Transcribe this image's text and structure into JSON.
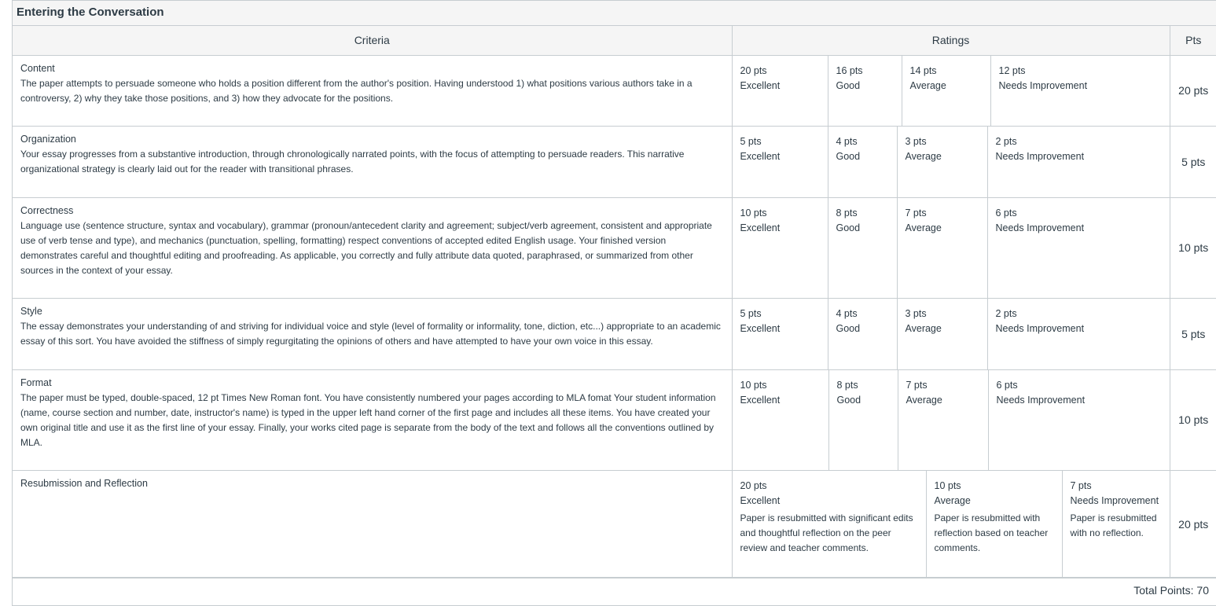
{
  "title": "Entering the Conversation",
  "headers": {
    "criteria": "Criteria",
    "ratings": "Ratings",
    "pts": "Pts"
  },
  "criteria": [
    {
      "name": "Content",
      "description": "The paper attempts to persuade someone who holds a position different from the author's position. Having understood 1) what positions various authors take in a controversy, 2) why they take those positions, and 3) how they advocate for the positions.",
      "points": "20 pts",
      "ratings": [
        {
          "pts": "20 pts",
          "label": "Excellent"
        },
        {
          "pts": "16 pts",
          "label": "Good"
        },
        {
          "pts": "14 pts",
          "label": "Average"
        },
        {
          "pts": "12 pts",
          "label": "Needs Improvement"
        }
      ]
    },
    {
      "name": "Organization",
      "description": "Your essay progresses from a substantive introduction, through chronologically narrated points, with the focus of attempting to persuade readers. This narrative organizational strategy is clearly laid out for the reader with transitional phrases.",
      "points": "5 pts",
      "ratings": [
        {
          "pts": "5 pts",
          "label": "Excellent"
        },
        {
          "pts": "4 pts",
          "label": "Good"
        },
        {
          "pts": "3 pts",
          "label": "Average"
        },
        {
          "pts": "2 pts",
          "label": "Needs Improvement"
        }
      ]
    },
    {
      "name": "Correctness",
      "description": "Language use (sentence structure, syntax and vocabulary), grammar (pronoun/antecedent clarity and agreement; subject/verb agreement, consistent and appropriate use of verb tense and type), and mechanics (punctuation, spelling, formatting) respect conventions of accepted edited English usage. Your finished version demonstrates careful and thoughtful editing and proofreading. As applicable, you correctly and fully attribute data quoted, paraphrased, or summarized from other sources in the context of your essay.",
      "points": "10 pts",
      "ratings": [
        {
          "pts": "10 pts",
          "label": "Excellent"
        },
        {
          "pts": "8 pts",
          "label": "Good"
        },
        {
          "pts": "7 pts",
          "label": "Average"
        },
        {
          "pts": "6 pts",
          "label": "Needs Improvement"
        }
      ]
    },
    {
      "name": "Style",
      "description": "The essay demonstrates your understanding of and striving for individual voice and style (level of formality or informality, tone, diction, etc...) appropriate to an academic essay of this sort. You have avoided the stiffness of simply regurgitating the opinions of others and have attempted to have your own voice in this essay.",
      "points": "5 pts",
      "ratings": [
        {
          "pts": "5 pts",
          "label": "Excellent"
        },
        {
          "pts": "4 pts",
          "label": "Good"
        },
        {
          "pts": "3 pts",
          "label": "Average"
        },
        {
          "pts": "2 pts",
          "label": "Needs Improvement"
        }
      ]
    },
    {
      "name": "Format",
      "description": "The paper must be typed, double-spaced, 12 pt Times New Roman font. You have consistently numbered your pages according to MLA fomat Your student information (name, course section and number, date, instructor's name) is typed in the upper left hand corner of the first page and includes all these items. You have created your own original title and use it as the first line of your essay. Finally, your works cited page is separate from the body of the text and follows all the conventions outlined by MLA.",
      "points": "10 pts",
      "ratings": [
        {
          "pts": "10 pts",
          "label": "Excellent"
        },
        {
          "pts": "8 pts",
          "label": "Good"
        },
        {
          "pts": "7 pts",
          "label": "Average"
        },
        {
          "pts": "6 pts",
          "label": "Needs Improvement"
        }
      ]
    },
    {
      "name": "Resubmission and Reflection",
      "description": "",
      "points": "20 pts",
      "ratings": [
        {
          "pts": "20 pts",
          "label": "Excellent",
          "desc": "Paper is resubmitted with significant edits and thoughtful reflection on the peer review and teacher comments."
        },
        {
          "pts": "10 pts",
          "label": "Average",
          "desc": "Paper is resubmitted with reflection based on teacher comments."
        },
        {
          "pts": "7 pts",
          "label": "Needs Improvement",
          "desc": "Paper is resubmitted with no reflection."
        }
      ]
    }
  ],
  "total": "Total Points: 70"
}
